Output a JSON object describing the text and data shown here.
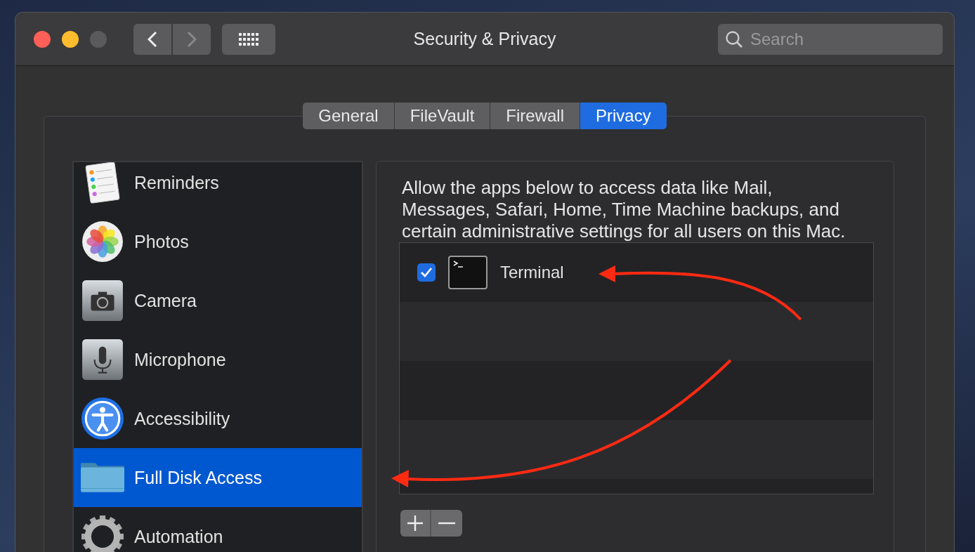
{
  "window": {
    "title": "Security & Privacy"
  },
  "search": {
    "placeholder": "Search"
  },
  "tabs": [
    {
      "label": "General",
      "selected": false
    },
    {
      "label": "FileVault",
      "selected": false
    },
    {
      "label": "Firewall",
      "selected": false
    },
    {
      "label": "Privacy",
      "selected": true
    }
  ],
  "sidebar": {
    "items": [
      {
        "label": "Reminders",
        "kind": "reminders",
        "selected": false
      },
      {
        "label": "Photos",
        "kind": "photos",
        "selected": false
      },
      {
        "label": "Camera",
        "kind": "camera",
        "selected": false
      },
      {
        "label": "Microphone",
        "kind": "microphone",
        "selected": false
      },
      {
        "label": "Accessibility",
        "kind": "accessibility",
        "selected": false
      },
      {
        "label": "Full Disk Access",
        "kind": "folder",
        "selected": true
      },
      {
        "label": "Automation",
        "kind": "gear",
        "selected": false
      }
    ]
  },
  "description": "Allow the apps below to access data like Mail, Messages, Safari, Home, Time Machine backups, and certain administrative settings for all users on this Mac.",
  "apps": [
    {
      "name": "Terminal",
      "checked": true
    }
  ]
}
